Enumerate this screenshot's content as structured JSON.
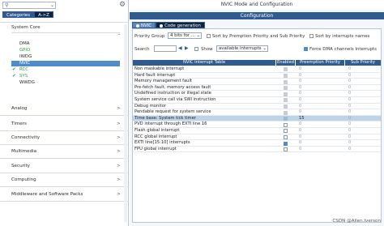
{
  "left": {
    "tabs": [
      "Categories",
      "A->Z"
    ],
    "section_system_core": "System Core",
    "system_items": [
      {
        "label": "DMA",
        "state": "none"
      },
      {
        "label": "GPIO",
        "state": "green"
      },
      {
        "label": "IWDG",
        "state": "none"
      },
      {
        "label": "NVIC",
        "state": "selected"
      },
      {
        "label": "RCC",
        "state": "check"
      },
      {
        "label": "SYS",
        "state": "check"
      },
      {
        "label": "WWDG",
        "state": "none"
      }
    ],
    "categories": [
      "Analog",
      "Timers",
      "Connectivity",
      "Multimedia",
      "Security",
      "Computing",
      "Middleware and Software Packs"
    ]
  },
  "right": {
    "title": "NVIC Mode and Configuration",
    "configuration": "Configuration",
    "tabs": [
      "NVIC",
      "Code generation"
    ],
    "priority_group_label": "Priority Group",
    "priority_group_value": "4 bits for ...",
    "sort_preemption_label": "Sort by Premption Priority and Sub Priority",
    "sort_interrupts_label": "Sort by interrupts names",
    "search_label": "Search",
    "show_label": "Show",
    "show_value": "available interrupts",
    "force_dma_label": "Force DMA channels Interrupts",
    "table": {
      "headers": [
        "NVIC Interrupt Table",
        "Enabled",
        "Preemption Priority",
        "Sub Priority"
      ],
      "rows": [
        {
          "name": "Non maskable interrupt",
          "enabled": "grey",
          "pre": "0",
          "sub": "0",
          "selected": false
        },
        {
          "name": "Hard fault interrupt",
          "enabled": "grey",
          "pre": "0",
          "sub": "0",
          "selected": false
        },
        {
          "name": "Memory management fault",
          "enabled": "grey",
          "pre": "0",
          "sub": "0",
          "selected": false
        },
        {
          "name": "Pre-fetch fault, memory access fault",
          "enabled": "grey",
          "pre": "0",
          "sub": "0",
          "selected": false
        },
        {
          "name": "Undefined instruction or illegal state",
          "enabled": "grey",
          "pre": "0",
          "sub": "0",
          "selected": false
        },
        {
          "name": "System service call via SWI instruction",
          "enabled": "grey",
          "pre": "0",
          "sub": "0",
          "selected": false
        },
        {
          "name": "Debug monitor",
          "enabled": "grey",
          "pre": "0",
          "sub": "0",
          "selected": false
        },
        {
          "name": "Pendable request for system service",
          "enabled": "grey",
          "pre": "0",
          "sub": "0",
          "selected": false
        },
        {
          "name": "Time base: System tick timer",
          "enabled": "on",
          "pre": "15",
          "sub": "0",
          "selected": true
        },
        {
          "name": "PVD interrupt through EXTI line 16",
          "enabled": "off",
          "pre": "0",
          "sub": "0",
          "selected": false
        },
        {
          "name": "Flash global interrupt",
          "enabled": "off",
          "pre": "0",
          "sub": "0",
          "selected": false
        },
        {
          "name": "RCC global interrupt",
          "enabled": "off",
          "pre": "0",
          "sub": "0",
          "selected": false
        },
        {
          "name": "EXTI line[15:10] interrupts",
          "enabled": "blue",
          "pre": "0",
          "sub": "0",
          "selected": false
        },
        {
          "name": "FPU global interrupt",
          "enabled": "off",
          "pre": "0",
          "sub": "0",
          "selected": false
        }
      ]
    }
  },
  "watermark": "CSDN @Allen.Iverson",
  "colors": {
    "accent": "#2f5b8f",
    "selected": "#4f8cc9",
    "check": "#2fa34a"
  }
}
